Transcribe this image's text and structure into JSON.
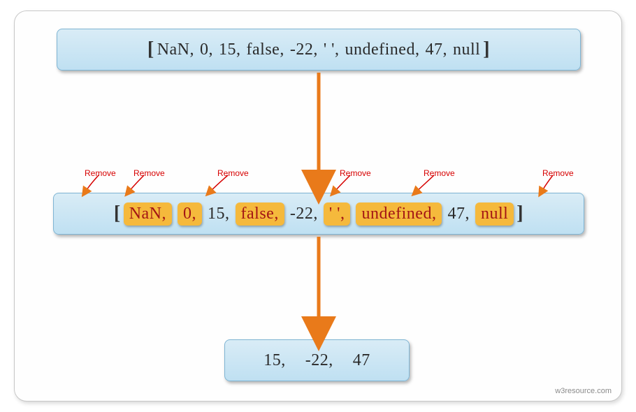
{
  "input_array": {
    "bracket_open": "[",
    "bracket_close": "]",
    "items": [
      "NaN,",
      "0,",
      "15,",
      "false,",
      "-22,",
      "'  ',",
      "undefined,",
      "47,",
      "null"
    ]
  },
  "annotated_array": {
    "bracket_open": "[",
    "bracket_close": "]",
    "items": [
      {
        "text": "NaN,",
        "highlighted": true
      },
      {
        "text": "0,",
        "highlighted": true
      },
      {
        "text": "15,",
        "highlighted": false
      },
      {
        "text": "false,",
        "highlighted": true
      },
      {
        "text": "-22,",
        "highlighted": false
      },
      {
        "text": "'  ',",
        "highlighted": true
      },
      {
        "text": "undefined,",
        "highlighted": true
      },
      {
        "text": "47,",
        "highlighted": false
      },
      {
        "text": "null",
        "highlighted": true
      }
    ]
  },
  "remove_labels": [
    "Remove",
    "Remove",
    "Remove",
    "Remove",
    "Remove",
    "Remove"
  ],
  "result_array": {
    "items": [
      "15,",
      "-22,",
      "47"
    ]
  },
  "attribution": "w3resource.com",
  "colors": {
    "box_bg_top": "#d9ecf6",
    "box_bg_bottom": "#bfe0f2",
    "box_border": "#7fb5d4",
    "highlight_bg": "#f5b93c",
    "highlight_text": "#a31515",
    "arrow": "#e97a1a",
    "remove_text": "#d60000"
  }
}
